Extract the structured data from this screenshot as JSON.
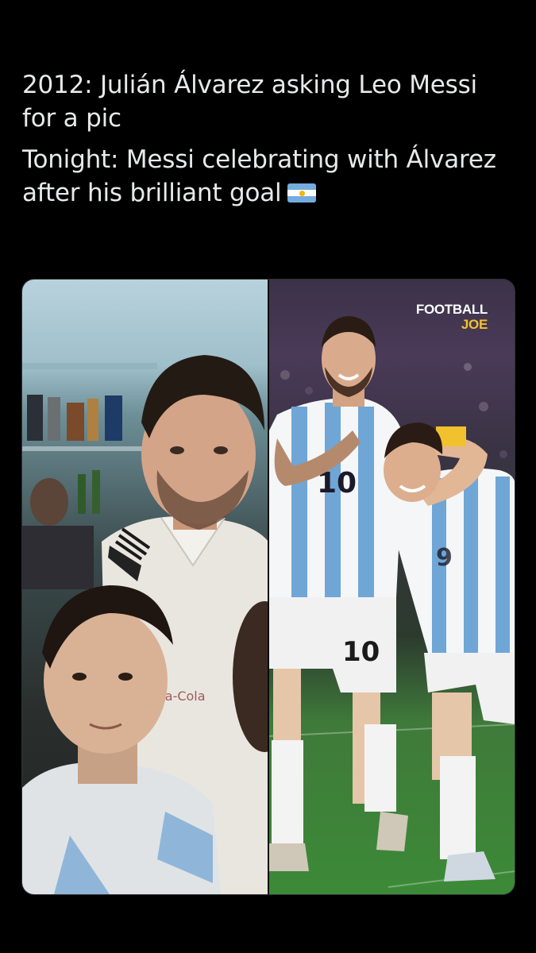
{
  "tweet": {
    "line1": "2012: Julián Álvarez asking Leo Messi for a pic",
    "line2": "Tonight: Messi celebrating with Álvarez after his brilliant goal",
    "flag_icon": "argentina-flag-emoji"
  },
  "media": {
    "watermark_line1": "FOOTBALL",
    "watermark_line2": "JOE",
    "shirt_number_messi": "10",
    "shirt_number_alvarez": "9",
    "colors": {
      "background": "#000000",
      "text": "#e7e9ea",
      "watermark_accent": "#f2c12e"
    }
  }
}
